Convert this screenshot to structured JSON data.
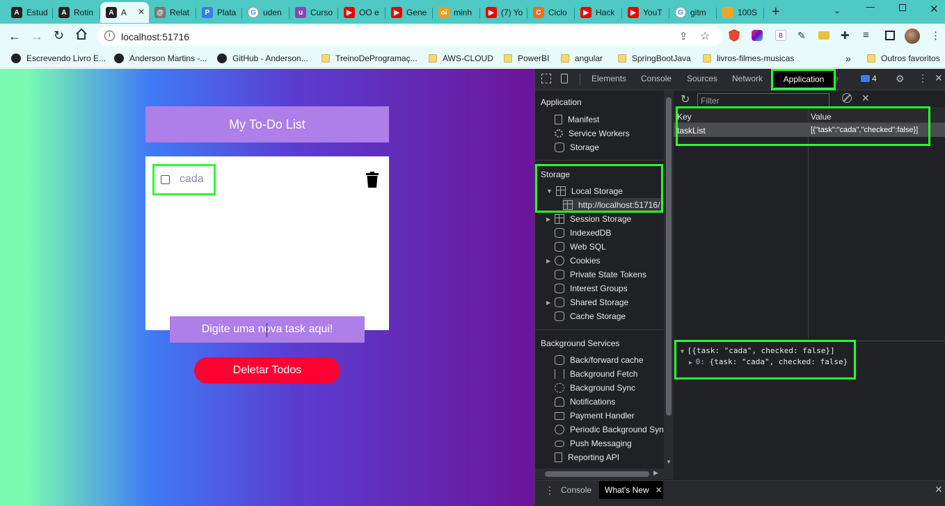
{
  "browser": {
    "tabs": [
      {
        "label": "Estud",
        "color": "#222",
        "glyph": "A"
      },
      {
        "label": "Rotin",
        "color": "#222",
        "glyph": "A"
      },
      {
        "label": "A",
        "color": "#222",
        "glyph": "A",
        "active": true
      },
      {
        "label": "Relat",
        "color": "#777",
        "glyph": "@"
      },
      {
        "label": "Plata",
        "color": "#3b7de0",
        "glyph": "P"
      },
      {
        "label": "uden",
        "color": "#ffffff",
        "glyph": "G"
      },
      {
        "label": "Curso",
        "color": "#8e44ad",
        "glyph": "u"
      },
      {
        "label": "OO e",
        "color": "#e00",
        "glyph": "▶"
      },
      {
        "label": "Gene",
        "color": "#e00",
        "glyph": "▶"
      },
      {
        "label": "minh",
        "color": "#f39c12",
        "glyph": "oi"
      },
      {
        "label": "(7) Yo",
        "color": "#e00",
        "glyph": "▶"
      },
      {
        "label": "Ciclo",
        "color": "#f26b1d",
        "glyph": "C"
      },
      {
        "label": "Hack",
        "color": "#e00",
        "glyph": "▶"
      },
      {
        "label": "YouT",
        "color": "#e00",
        "glyph": "▶"
      },
      {
        "label": "gitm",
        "color": "#ffffff",
        "glyph": "G"
      },
      {
        "label": "100S",
        "color": "#f7a41d",
        "glyph": ""
      }
    ],
    "url": "localhost:51716",
    "bookmarks": [
      {
        "label": "Escrevendo Livro E...",
        "type": "icon"
      },
      {
        "label": "Anderson Martins -...",
        "type": "icon"
      },
      {
        "label": "GitHub - Anderson...",
        "type": "icon"
      },
      {
        "label": "TreinoDeProgramaç...",
        "type": "folder"
      },
      {
        "label": "AWS-CLOUD",
        "type": "folder"
      },
      {
        "label": "PowerBI",
        "type": "folder"
      },
      {
        "label": "angular",
        "type": "folder"
      },
      {
        "label": "SpringBootJava",
        "type": "folder"
      },
      {
        "label": "livros-filmes-musicas",
        "type": "folder"
      }
    ],
    "bookmarks_more": "»",
    "other_bookmarks": "Outros favoritos"
  },
  "app": {
    "title": "My To-Do List",
    "tasks": [
      {
        "task": "cada",
        "checked": false
      }
    ],
    "input_placeholder": "Digite uma nova task aqui!",
    "delete_all_label": "Deletar Todos",
    "colors": {
      "header": "#ae7ee9",
      "delete": "#ff0033"
    }
  },
  "devtools": {
    "tabs": [
      "Elements",
      "Console",
      "Sources",
      "Network",
      "Application"
    ],
    "active_tab": "Application",
    "issues_count": "4",
    "filter_placeholder": "Filter",
    "sections": {
      "application": {
        "title": "Application",
        "items": [
          "Manifest",
          "Service Workers",
          "Storage"
        ]
      },
      "storage": {
        "title": "Storage",
        "local_storage": "Local Storage",
        "local_storage_origin": "http://localhost:51716/",
        "items": [
          "Session Storage",
          "IndexedDB",
          "Web SQL",
          "Cookies",
          "Private State Tokens",
          "Interest Groups",
          "Shared Storage",
          "Cache Storage"
        ]
      },
      "background": {
        "title": "Background Services",
        "items": [
          "Back/forward cache",
          "Background Fetch",
          "Background Sync",
          "Notifications",
          "Payment Handler",
          "Periodic Background Sync",
          "Push Messaging",
          "Reporting API"
        ]
      }
    },
    "table": {
      "headers": [
        "Key",
        "Value"
      ],
      "rows": [
        {
          "key": "taskList",
          "value": "[{\"task\":\"cada\",\"checked\":false}]"
        }
      ]
    },
    "preview": {
      "line1": "[{task: \"cada\", checked: false}]",
      "line2_index": "0:",
      "line2_value": "{task: \"cada\", checked: false}"
    },
    "drawer_tabs": [
      "Console",
      "What's New"
    ],
    "highlight_color": "#26ff2a"
  }
}
